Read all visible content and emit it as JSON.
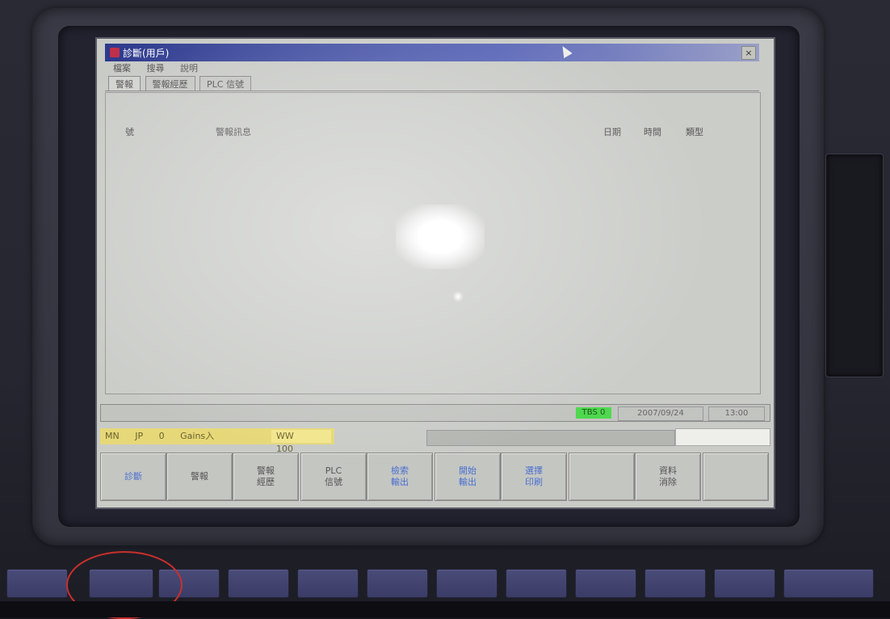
{
  "window": {
    "title": "診斷(用戶)",
    "close_glyph": "×",
    "menu": [
      "檔案",
      "搜尋",
      "說明"
    ]
  },
  "tabs": [
    {
      "label": "警報"
    },
    {
      "label": "警報經歷"
    },
    {
      "label": "PLC 信號"
    }
  ],
  "table": {
    "headers": {
      "num": "號",
      "message": "警報訊息",
      "date": "日期",
      "time": "時間",
      "type": "類型"
    }
  },
  "status": {
    "tbs": "TBS 0",
    "date": "2007/09/24",
    "time": "13:00"
  },
  "mode_bar": {
    "items": [
      "MN",
      "JP",
      "0",
      "Gains入"
    ],
    "ww_label": "WW",
    "ww_value": "100"
  },
  "softkeys": [
    {
      "label": "診斷",
      "color": "blue"
    },
    {
      "label": "警報",
      "color": "gray"
    },
    {
      "label": "警報\n經歷",
      "color": "gray"
    },
    {
      "label": "PLC\n信號",
      "color": "gray"
    },
    {
      "label": "檢索\n輸出",
      "color": "blue"
    },
    {
      "label": "開始\n輸出",
      "color": "blue"
    },
    {
      "label": "選擇\n印刷",
      "color": "blue"
    },
    {
      "label": "",
      "color": "gray"
    },
    {
      "label": "資料\n消除",
      "color": "gray"
    },
    {
      "label": "",
      "color": "gray"
    }
  ]
}
